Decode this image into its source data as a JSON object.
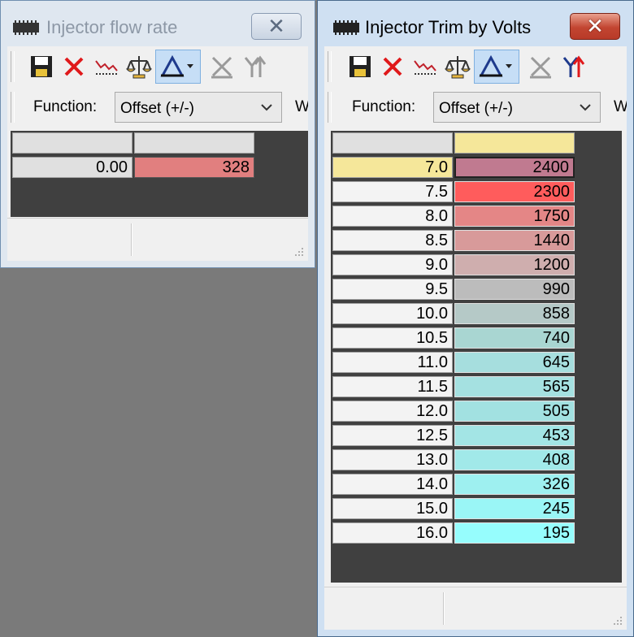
{
  "background_color": "#7a7a7a",
  "windows": [
    {
      "title": "Injector flow rate",
      "active": false,
      "function_label": "Function:",
      "function_value": "Offset (+/-)",
      "more_label": "W",
      "row_axis": [
        "0.00"
      ],
      "values": [
        "328"
      ],
      "value_colors": [
        "#e17f7f"
      ]
    },
    {
      "title": "Injector Trim by Volts",
      "active": true,
      "function_label": "Function:",
      "function_value": "Offset (+/-)",
      "more_label": "W",
      "row_axis": [
        "7.0",
        "7.5",
        "8.0",
        "8.5",
        "9.0",
        "9.5",
        "10.0",
        "10.5",
        "11.0",
        "11.5",
        "12.0",
        "12.5",
        "13.0",
        "14.0",
        "15.0",
        "16.0"
      ],
      "values": [
        "2400",
        "2300",
        "1750",
        "1440",
        "1200",
        "990",
        "858",
        "740",
        "645",
        "565",
        "505",
        "453",
        "408",
        "326",
        "245",
        "195"
      ],
      "value_colors": [
        "#c07a90",
        "#ff5c5c",
        "#e48686",
        "#d89a9a",
        "#cfaeae",
        "#bcbcbc",
        "#b5c9c7",
        "#a9d6d2",
        "#a6dede",
        "#a5e1e1",
        "#a2e1e1",
        "#a3e5e5",
        "#a1e9e9",
        "#9ef0f0",
        "#9af6f6",
        "#96fdfd"
      ],
      "selected_row": 0
    }
  ],
  "toolbar_icons": [
    "save-icon",
    "delete-icon",
    "graph-icon",
    "scale-icon",
    "interpolate-dropdown-icon",
    "clear-axis-icon",
    "merge-icon"
  ]
}
